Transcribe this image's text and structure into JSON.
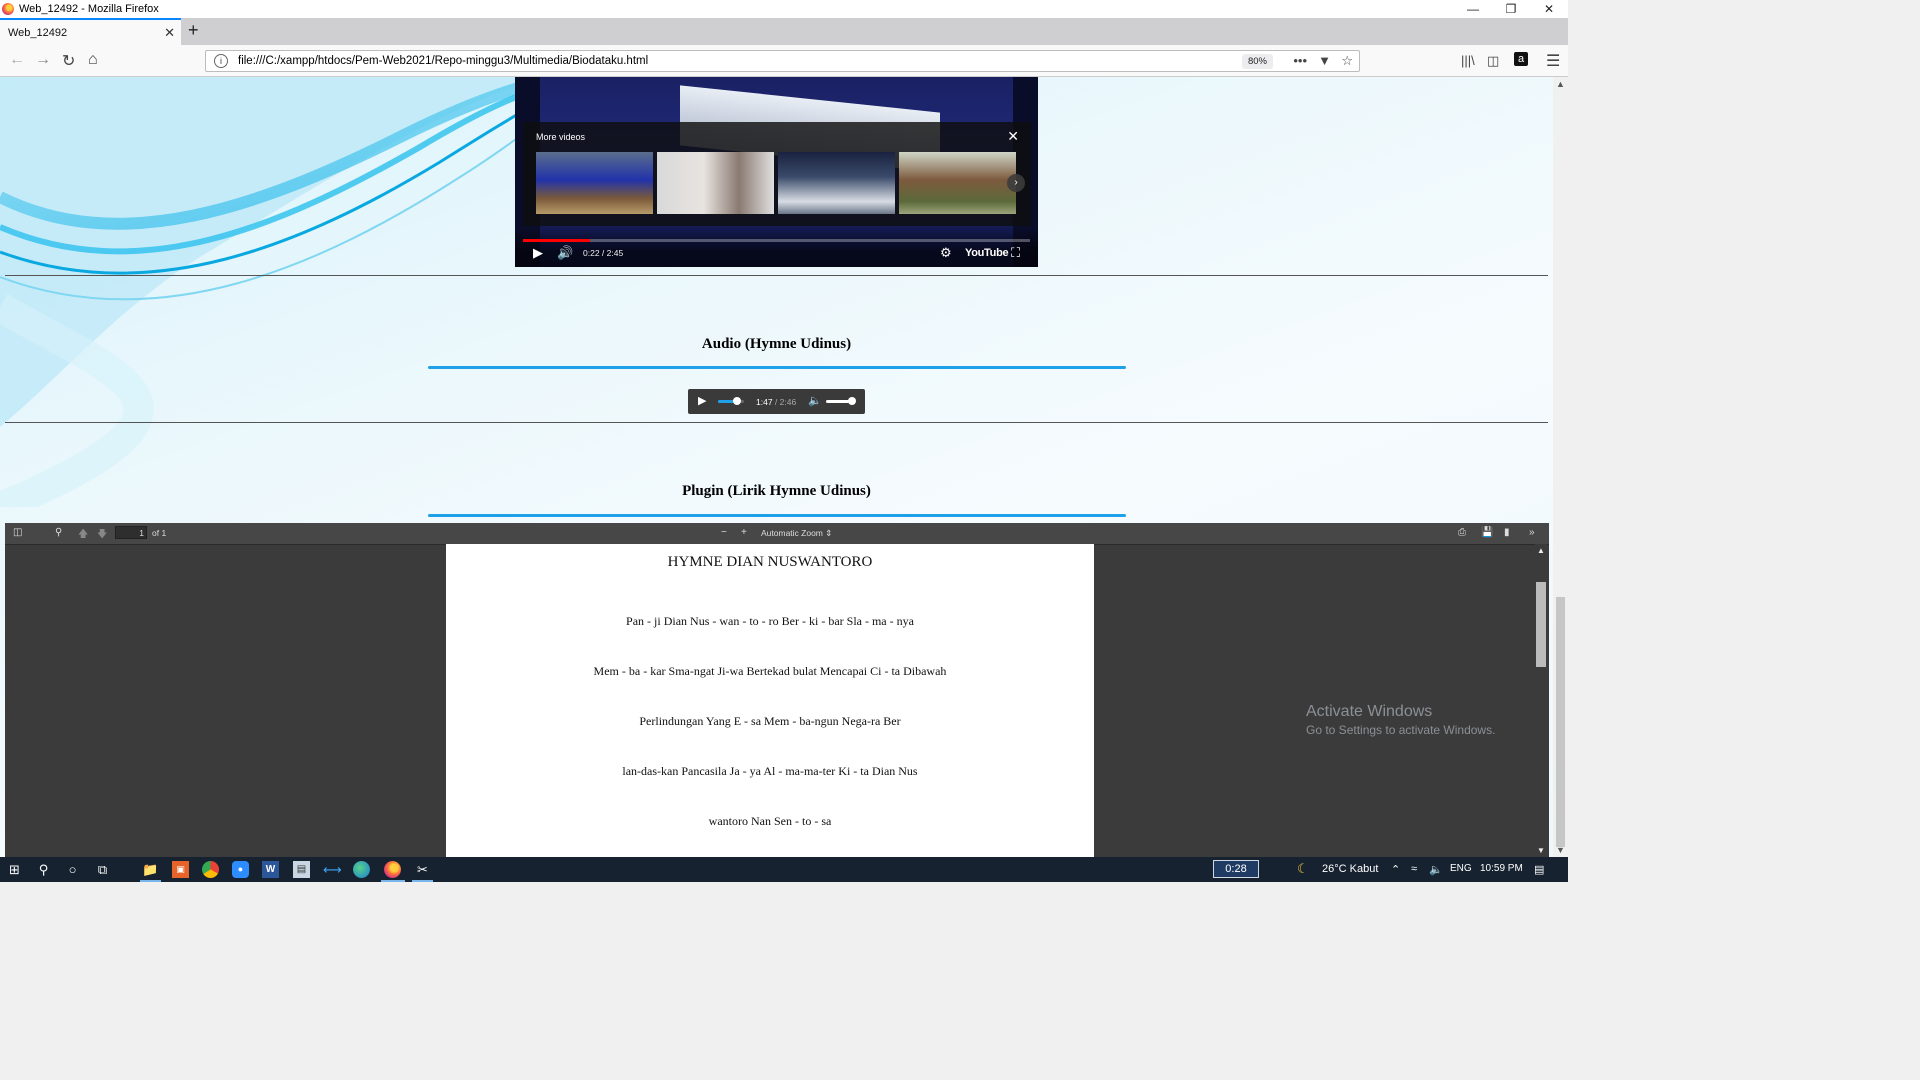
{
  "window": {
    "title": "Web_12492 - Mozilla Firefox",
    "controls": [
      "—",
      "❐",
      "✕"
    ]
  },
  "tabs": [
    {
      "label": "Web_12492",
      "close": "✕"
    }
  ],
  "new_tab": "+",
  "navbar": {
    "url": "file:///C:/xampp/htdocs/Pem-Web2021/Repo-minggu3/Multimedia/Biodataku.html",
    "zoom": "80%",
    "more": "•••"
  },
  "video": {
    "more_videos_label": "More videos",
    "time_current": "0:22",
    "time_total": "2:45",
    "time_sep": " / ",
    "youtube_label": "YouTube",
    "progress": 0.133
  },
  "audio_section": {
    "title": "Audio (Hymne Udinus)",
    "time_current": "1:47",
    "time_total": "/ 2:46",
    "progress": 0.64,
    "volume": 1.0
  },
  "plugin_section": {
    "title": "Plugin (Lirik Hymne Udinus)"
  },
  "pdf": {
    "page_number": "1",
    "page_total": "of 1",
    "zoom_mode": "Automatic Zoom",
    "doc_title": "HYMNE DIAN NUSWANTORO",
    "lines": [
      "Pan - ji Dian Nus - wan - to - ro Ber - ki - bar Sla - ma - nya",
      "Mem - ba - kar Sma-ngat Ji-wa Bertekad bulat Mencapai Ci - ta Dibawah",
      "Perlindungan Yang E - sa Mem - ba-ngun Nega-ra Ber",
      "lan-das-kan Pancasila Ja - ya Al - ma-ma-ter Ki - ta Dian Nus",
      "wantoro Nan Sen - to - sa"
    ]
  },
  "watermark": {
    "title": "Activate Windows",
    "subtitle": "Go to Settings to activate Windows."
  },
  "taskbar": {
    "timer": "0:28",
    "weather": "26°C  Kabut",
    "language": "ENG",
    "clock": "10:59 PM"
  },
  "colors": {
    "accent_blue": "#1ea1e8",
    "youtube_red": "#ff0000",
    "pdf_bg": "#3b3b3b",
    "taskbar": "#16222f"
  }
}
